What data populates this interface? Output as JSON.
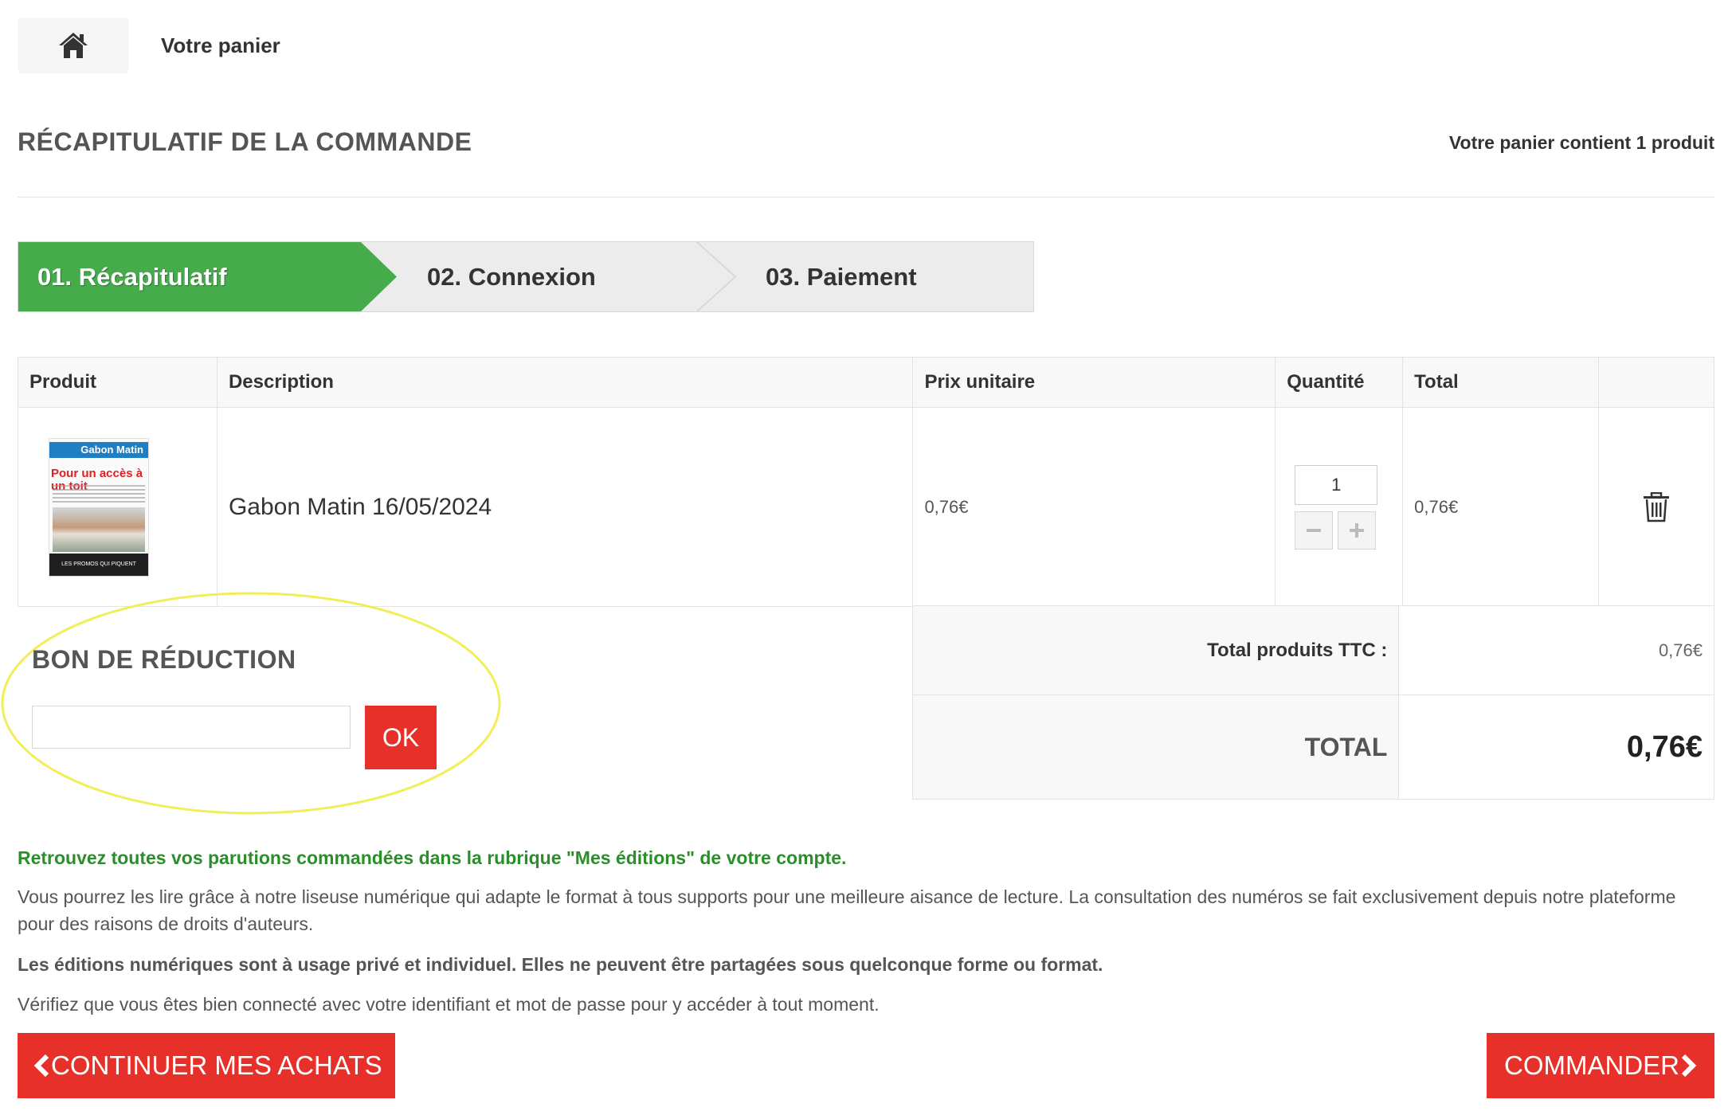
{
  "breadcrumb": {
    "home_icon": "home-icon",
    "current": "Votre panier"
  },
  "header": {
    "title": "RÉCAPITULATIF DE LA COMMANDE",
    "cart_count": "Votre panier contient 1 produit"
  },
  "steps": [
    {
      "label": "01. Récapitulatif",
      "active": true
    },
    {
      "label": "02. Connexion",
      "active": false
    },
    {
      "label": "03. Paiement",
      "active": false
    }
  ],
  "cart_table": {
    "headers": [
      "Produit",
      "Description",
      "Prix unitaire",
      "Quantité",
      "Total",
      ""
    ],
    "rows": [
      {
        "thumbnail": {
          "masthead": "Gabon Matin",
          "headline": "Pour un accès à un toit",
          "footer": "LES PROMOS QUI PIQUENT"
        },
        "description": "Gabon Matin 16/05/2024",
        "unit_price": "0,76€",
        "quantity": "1",
        "total": "0,76€"
      }
    ]
  },
  "coupon": {
    "title": "BON DE RÉDUCTION",
    "input_value": "",
    "button_label": "OK"
  },
  "totals": {
    "products_label": "Total produits TTC :",
    "products_value": "0,76€",
    "total_label": "TOTAL",
    "total_value": "0,76€"
  },
  "info": {
    "green": "Retrouvez toutes vos parutions commandées dans la rubrique \"Mes éditions\" de votre compte.",
    "p1": "Vous pourrez les lire grâce à notre liseuse numérique qui adapte le format à tous supports pour une meilleure aisance de lecture. La consultation des numéros se fait exclusivement depuis notre plateforme pour des raisons de droits d'auteurs.",
    "bold": "Les éditions numériques sont à usage privé et individuel. Elles ne peuvent être partagées sous quelconque forme ou format.",
    "p2": "Vérifiez que vous êtes bien connecté avec votre identifiant et mot de passe pour y accéder à tout moment."
  },
  "buttons": {
    "continue": "CONTINUER MES ACHATS",
    "order": "COMMANDER"
  },
  "colors": {
    "green": "#46ac4b",
    "red": "#e8302a",
    "highlight": "#f2ee5a"
  }
}
